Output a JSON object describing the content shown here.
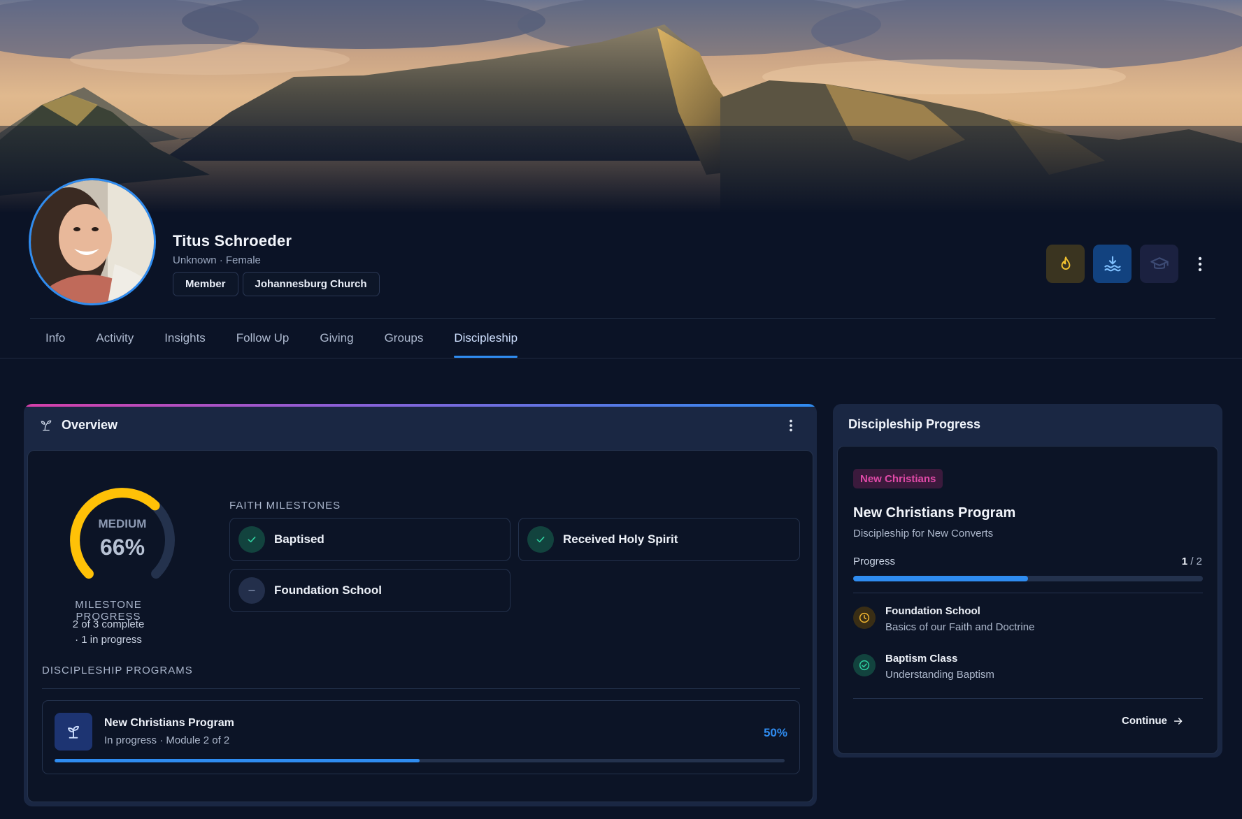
{
  "profile": {
    "name": "Titus Schroeder",
    "subtitle": "Unknown · Female",
    "chips": [
      "Member",
      "Johannesburg Church"
    ]
  },
  "actions": {
    "icons": [
      "fire-icon",
      "baptism-water-icon",
      "graduation-cap-icon",
      "more-vertical-icon"
    ],
    "colors": {
      "fire": "#f2c230",
      "water": "#4aa3ff",
      "grad": "#3c4a73"
    }
  },
  "tabs": [
    {
      "label": "Info"
    },
    {
      "label": "Activity"
    },
    {
      "label": "Insights"
    },
    {
      "label": "Follow Up"
    },
    {
      "label": "Giving"
    },
    {
      "label": "Groups"
    },
    {
      "label": "Discipleship",
      "active": true
    }
  ],
  "overview": {
    "title": "Overview",
    "gauge": {
      "label": "MEDIUM",
      "value_text": "66%",
      "fraction": 0.66,
      "color": "#ffc107"
    },
    "milestone_progress": {
      "title": "MILESTONE PROGRESS",
      "line1": "2 of 3 complete",
      "line2": "· 1 in progress"
    },
    "faith_milestones_title": "FAITH MILESTONES",
    "milestones": [
      {
        "label": "Baptised",
        "status": "done"
      },
      {
        "label": "Received Holy Spirit",
        "status": "done"
      },
      {
        "label": "Foundation School",
        "status": "pending"
      }
    ],
    "programs_title": "DISCIPLESHIP PROGRAMS",
    "program": {
      "name": "New Christians Program",
      "sub": "In progress · Module 2 of 2",
      "percent_text": "50%",
      "fraction": 0.5
    }
  },
  "discipleship_progress": {
    "title": "Discipleship Progress",
    "badge": "New Christians",
    "program_name": "New Christians Program",
    "program_sub": "Discipleship for New Converts",
    "progress_label": "Progress",
    "progress_done": "1",
    "progress_total": "/ 2",
    "fraction": 0.5,
    "modules": [
      {
        "name": "Foundation School",
        "desc": "Basics of our Faith and Doctrine",
        "status": "in-progress"
      },
      {
        "name": "Baptism Class",
        "desc": "Understanding Baptism",
        "status": "complete"
      }
    ],
    "continue_label": "Continue"
  }
}
